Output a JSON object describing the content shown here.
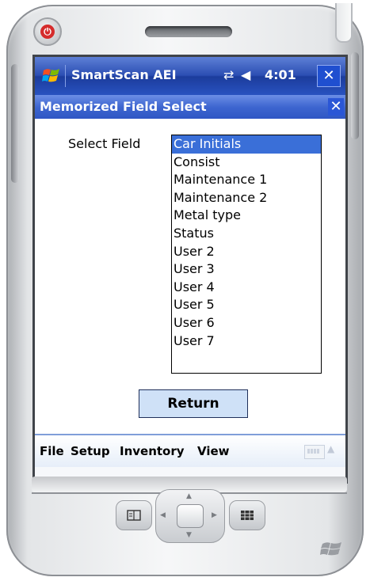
{
  "window": {
    "app_name": "SmartScan AEI",
    "clock": "4:01",
    "close_glyph": "✕"
  },
  "dialog": {
    "title": "Memorized Field Select",
    "close_glyph": "✕",
    "field_label": "Select Field",
    "items": [
      "Car Initials",
      "Consist",
      "Maintenance 1",
      "Maintenance 2",
      "Metal type",
      "Status",
      "User 2",
      "User 3",
      "User 4",
      "User 5",
      "User 6",
      "User 7"
    ],
    "selected_item": "Car Initials",
    "return_label": "Return"
  },
  "menubar": {
    "items": [
      "File",
      "Setup",
      "Inventory",
      "View"
    ]
  },
  "icons": {
    "power": "power-icon",
    "windows_start": "windows-logo-icon",
    "connectivity": "connectivity-icon",
    "volume": "volume-icon",
    "keyboard": "keyboard-icon"
  },
  "colors": {
    "titlebar": "#2c4fb3",
    "selection": "#3a6fd8",
    "return_button": "#cfe1f7",
    "power_button": "#d52b2b"
  }
}
